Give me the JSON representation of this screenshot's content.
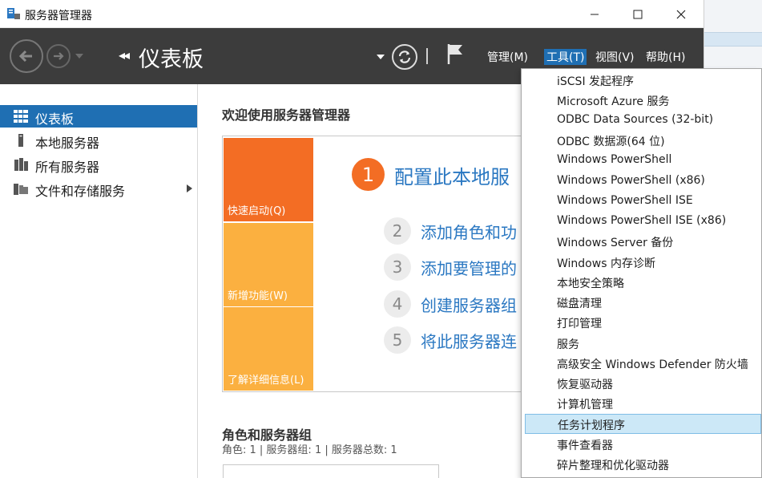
{
  "window": {
    "title": "服务器管理器",
    "controls": [
      "minimize",
      "maximize",
      "close"
    ]
  },
  "header": {
    "page_title": "仪表板",
    "menus": [
      {
        "label": "管理(M)",
        "active": false
      },
      {
        "label": "工具(T)",
        "active": true
      },
      {
        "label": "视图(V)",
        "active": false
      },
      {
        "label": "帮助(H)",
        "active": false
      }
    ]
  },
  "sidebar": {
    "items": [
      {
        "label": "仪表板",
        "icon": "dashboard-icon",
        "selected": true
      },
      {
        "label": "本地服务器",
        "icon": "local-server-icon",
        "selected": false
      },
      {
        "label": "所有服务器",
        "icon": "all-servers-icon",
        "selected": false
      },
      {
        "label": "文件和存储服务",
        "icon": "file-storage-icon",
        "selected": false,
        "has_children": true
      }
    ]
  },
  "main": {
    "welcome_title": "欢迎使用服务器管理器",
    "tiles": [
      {
        "label": "快速启动(Q)",
        "color": "#f36d24"
      },
      {
        "label": "新增功能(W)",
        "color": "#fbb040"
      },
      {
        "label": "了解详细信息(L)",
        "color": "#fbb040"
      }
    ],
    "steps": [
      {
        "num": "1",
        "text": "配置此本地服"
      },
      {
        "num": "2",
        "text": "添加角色和功"
      },
      {
        "num": "3",
        "text": "添加要管理的"
      },
      {
        "num": "4",
        "text": "创建服务器组"
      },
      {
        "num": "5",
        "text": "将此服务器连"
      }
    ],
    "roles_title": "角色和服务器组",
    "roles_summary": "角色: 1 | 服务器组: 1 | 服务器总数: 1"
  },
  "tools_menu": {
    "items": [
      "iSCSI 发起程序",
      "Microsoft Azure 服务",
      "ODBC Data Sources (32-bit)",
      "ODBC 数据源(64 位)",
      "Windows PowerShell",
      "Windows PowerShell (x86)",
      "Windows PowerShell ISE",
      "Windows PowerShell ISE (x86)",
      "Windows Server 备份",
      "Windows 内存诊断",
      "本地安全策略",
      "磁盘清理",
      "打印管理",
      "服务",
      "高级安全 Windows Defender 防火墙",
      "恢复驱动器",
      "计算机管理",
      "任务计划程序",
      "事件查看器",
      "碎片整理和优化驱动器"
    ],
    "highlighted": "任务计划程序"
  },
  "colors": {
    "header_bg": "#3c3c3c",
    "accent_blue": "#1f6fb3",
    "link_blue": "#2b78c2",
    "orange": "#f36d24",
    "amber": "#fbb040",
    "menu_highlight": "#cce8f7"
  }
}
